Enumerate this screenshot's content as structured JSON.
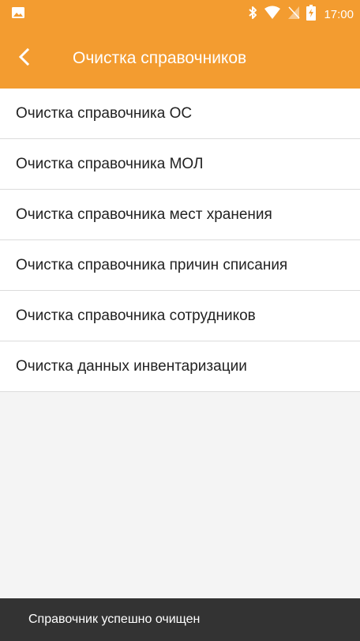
{
  "status_bar": {
    "time": "17:00",
    "icons": [
      "image-icon",
      "bluetooth-icon",
      "wifi-icon",
      "no-sim-icon",
      "battery-charging-icon"
    ]
  },
  "app_bar": {
    "title": "Очистка справочников",
    "back_icon": "back-arrow-icon"
  },
  "list": {
    "items": [
      {
        "label": "Очистка справочника ОС"
      },
      {
        "label": "Очистка справочника МОЛ"
      },
      {
        "label": "Очистка справочника мест хранения"
      },
      {
        "label": "Очистка справочника причин списания"
      },
      {
        "label": "Очистка справочника сотрудников"
      },
      {
        "label": "Очистка данных инвентаризации"
      }
    ]
  },
  "snackbar": {
    "message": "Справочник успешно очищен"
  },
  "colors": {
    "accent": "#f39c30",
    "snackbar_bg": "#333333",
    "divider": "#dcdcdc",
    "background": "#f4f4f4"
  }
}
